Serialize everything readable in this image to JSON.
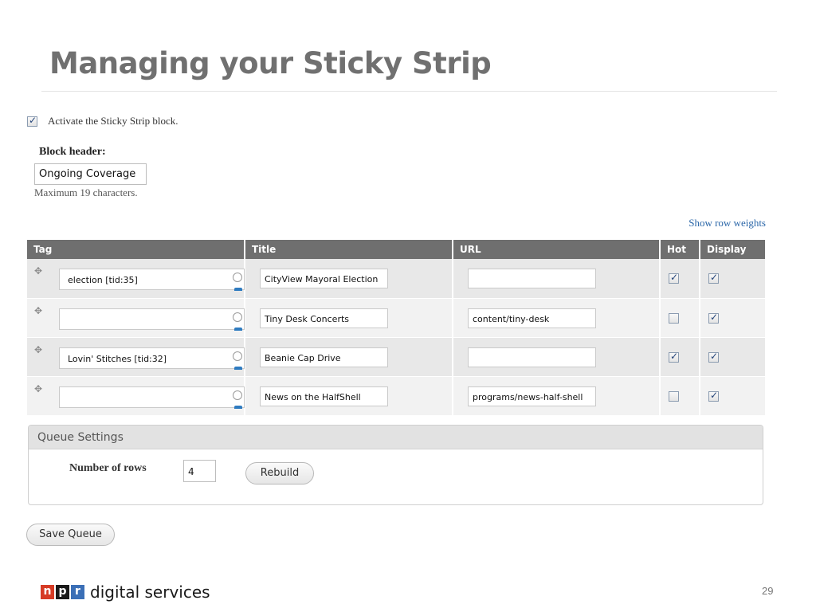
{
  "slide": {
    "title": "Managing your Sticky Strip",
    "page_number": "29"
  },
  "activate": {
    "label": "Activate the Sticky Strip block.",
    "checked": true
  },
  "block_header": {
    "label": "Block header:",
    "value": "Ongoing Coverage",
    "note": "Maximum 19 characters."
  },
  "show_row_weights": "Show row weights",
  "table": {
    "columns": [
      "Tag",
      "Title",
      "URL",
      "Hot",
      "Display"
    ],
    "rows": [
      {
        "tag": "election [tid:35]",
        "title": "CityView Mayoral Election",
        "url": "",
        "hot": true,
        "display": true
      },
      {
        "tag": "",
        "title": "Tiny Desk Concerts",
        "url": "content/tiny-desk",
        "hot": false,
        "display": true
      },
      {
        "tag": "Lovin' Stitches [tid:32]",
        "title": "Beanie Cap Drive",
        "url": "",
        "hot": true,
        "display": true
      },
      {
        "tag": "",
        "title": "News on the HalfShell",
        "url": "programs/news-half-shell",
        "hot": false,
        "display": true
      }
    ]
  },
  "queue_settings": {
    "heading": "Queue Settings",
    "rows_label": "Number of rows",
    "rows_value": "4",
    "rebuild_label": "Rebuild"
  },
  "save_label": "Save Queue",
  "footer": {
    "logo_letters": [
      "n",
      "p",
      "r"
    ],
    "logo_text": "digital services"
  },
  "colors": {
    "header_gray": "#6f6f6f",
    "link_blue": "#2a66a8",
    "npr_red": "#d63b25",
    "npr_black": "#1a1a1a",
    "npr_blue": "#3b6fb6"
  }
}
